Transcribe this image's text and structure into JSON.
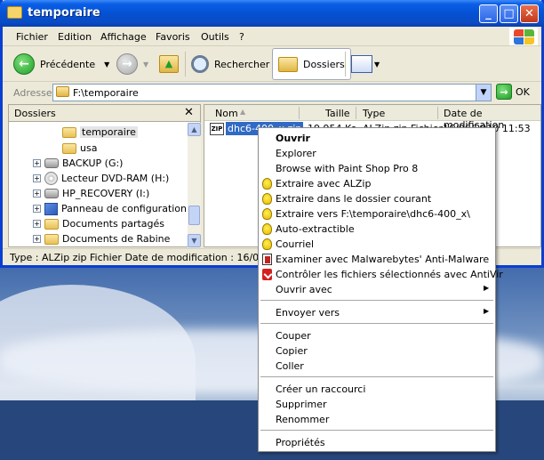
{
  "window": {
    "title": "temporaire",
    "min_glyph": "_",
    "max_glyph": "□",
    "close_glyph": "✕"
  },
  "menubar": [
    "Fichier",
    "Edition",
    "Affichage",
    "Favoris",
    "Outils",
    "?"
  ],
  "toolbar": {
    "back_label": "Précédente",
    "search_label": "Rechercher",
    "folders_label": "Dossiers"
  },
  "address": {
    "label": "Adresse",
    "value": "F:\\temporaire",
    "go_label": "OK"
  },
  "folders_pane": {
    "title": "Dossiers",
    "close_glyph": "✕",
    "items": [
      {
        "label": "temporaire",
        "kind": "folder",
        "selected": true
      },
      {
        "label": "usa",
        "kind": "folder"
      },
      {
        "label": "BACKUP (G:)",
        "kind": "drive",
        "expander": "+"
      },
      {
        "label": "Lecteur DVD-RAM (H:)",
        "kind": "cd",
        "expander": "+"
      },
      {
        "label": "HP_RECOVERY (I:)",
        "kind": "drive",
        "expander": "+"
      },
      {
        "label": "Panneau de configuration",
        "kind": "panel",
        "expander": "+"
      },
      {
        "label": "Documents partagés",
        "kind": "folder",
        "expander": "+"
      },
      {
        "label": "Documents de Rabine",
        "kind": "folder",
        "expander": "+"
      }
    ]
  },
  "file_list": {
    "columns": [
      "Nom",
      "Taille",
      "Type",
      "Date de modification"
    ],
    "rows": [
      {
        "name": "dhc6-400_x.zip",
        "size": "19 954 Ko",
        "type": "ALZip zip Fichier",
        "date": "16/06/2010 11:53"
      }
    ]
  },
  "status_bar": "Type : ALZip zip Fichier Date de modification : 16/06/2010",
  "context_menu": [
    {
      "label": "Ouvrir",
      "bold": true
    },
    {
      "label": "Explorer"
    },
    {
      "label": "Browse with Paint Shop Pro 8"
    },
    {
      "label": "Extraire avec ALZip",
      "icon": "alzip-icon"
    },
    {
      "label": "Extraire dans le dossier courant",
      "icon": "alzip-icon"
    },
    {
      "label": "Extraire vers F:\\temporaire\\dhc6-400_x\\",
      "icon": "alzip-icon"
    },
    {
      "label": "Auto-extractible",
      "icon": "alzip-icon"
    },
    {
      "label": "Courriel",
      "icon": "alzip-icon"
    },
    {
      "label": "Examiner avec Malwarebytes' Anti-Malware",
      "icon": "malwarebytes-icon"
    },
    {
      "label": "Contrôler les fichiers sélectionnés avec AntiVir",
      "icon": "antivir-icon"
    },
    {
      "label": "Ouvrir avec",
      "submenu": true
    },
    {
      "label": "Envoyer vers",
      "submenu": true
    },
    {
      "label": "Couper"
    },
    {
      "label": "Copier"
    },
    {
      "label": "Coller"
    },
    {
      "label": "Créer un raccourci"
    },
    {
      "label": "Supprimer"
    },
    {
      "label": "Renommer"
    },
    {
      "label": "Propriétés"
    }
  ],
  "glyphs": {
    "submenu_arrow": "▶",
    "dropdown": "▼",
    "back_arrow": "←",
    "forward_arrow": "→",
    "up_arrow": "▲",
    "down_arrow": "▼"
  }
}
